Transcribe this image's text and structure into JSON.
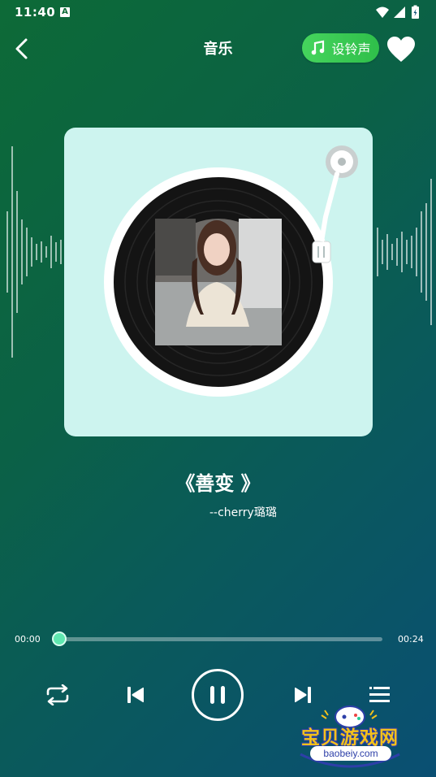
{
  "status": {
    "time": "11:40",
    "notif_icon": "A"
  },
  "header": {
    "title": "音乐",
    "ringtone_label": "设铃声"
  },
  "song": {
    "title": "《善变 》",
    "artist": "--cherry璐璐"
  },
  "player": {
    "time_current": "00:00",
    "time_total": "00:24",
    "progress": 0
  },
  "watermark": {
    "name": "宝贝游戏网",
    "url": "baobeiy.com"
  },
  "colors": {
    "accent": "#3ccb54",
    "thumb": "#5fe7b0",
    "card": "#cdf4ef"
  }
}
